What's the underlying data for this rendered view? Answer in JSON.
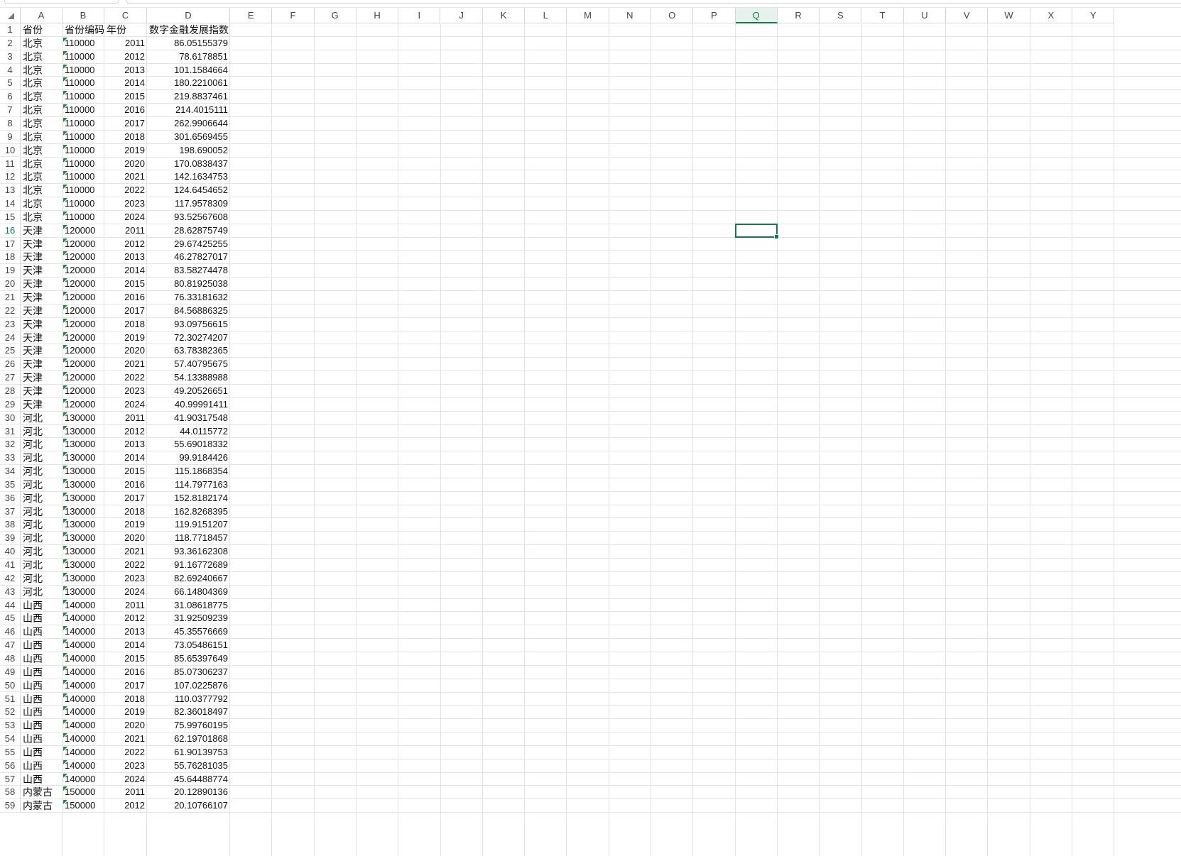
{
  "columns": [
    "A",
    "B",
    "C",
    "D",
    "E",
    "F",
    "G",
    "H",
    "I",
    "J",
    "K",
    "L",
    "M",
    "N",
    "O",
    "P",
    "Q",
    "R",
    "S",
    "T",
    "U",
    "V",
    "W",
    "X",
    "Y"
  ],
  "active_column": "Q",
  "active_row": 16,
  "selected_cell": "Q16",
  "rows": [
    {
      "n": "1",
      "a": "省份",
      "b": "省份编码",
      "c": "年份",
      "d": "数字金融发展指数",
      "header": true
    },
    {
      "n": "2",
      "a": "北京",
      "b": "110000",
      "c": "2011",
      "d": "86.05155379"
    },
    {
      "n": "3",
      "a": "北京",
      "b": "110000",
      "c": "2012",
      "d": "78.6178851"
    },
    {
      "n": "4",
      "a": "北京",
      "b": "110000",
      "c": "2013",
      "d": "101.1584664"
    },
    {
      "n": "5",
      "a": "北京",
      "b": "110000",
      "c": "2014",
      "d": "180.2210061"
    },
    {
      "n": "6",
      "a": "北京",
      "b": "110000",
      "c": "2015",
      "d": "219.8837461"
    },
    {
      "n": "7",
      "a": "北京",
      "b": "110000",
      "c": "2016",
      "d": "214.4015111"
    },
    {
      "n": "8",
      "a": "北京",
      "b": "110000",
      "c": "2017",
      "d": "262.9906644"
    },
    {
      "n": "9",
      "a": "北京",
      "b": "110000",
      "c": "2018",
      "d": "301.6569455"
    },
    {
      "n": "10",
      "a": "北京",
      "b": "110000",
      "c": "2019",
      "d": "198.690052"
    },
    {
      "n": "11",
      "a": "北京",
      "b": "110000",
      "c": "2020",
      "d": "170.0838437"
    },
    {
      "n": "12",
      "a": "北京",
      "b": "110000",
      "c": "2021",
      "d": "142.1634753"
    },
    {
      "n": "13",
      "a": "北京",
      "b": "110000",
      "c": "2022",
      "d": "124.6454652"
    },
    {
      "n": "14",
      "a": "北京",
      "b": "110000",
      "c": "2023",
      "d": "117.9578309"
    },
    {
      "n": "15",
      "a": "北京",
      "b": "110000",
      "c": "2024",
      "d": "93.52567608"
    },
    {
      "n": "16",
      "a": "天津",
      "b": "120000",
      "c": "2011",
      "d": "28.62875749"
    },
    {
      "n": "17",
      "a": "天津",
      "b": "120000",
      "c": "2012",
      "d": "29.67425255"
    },
    {
      "n": "18",
      "a": "天津",
      "b": "120000",
      "c": "2013",
      "d": "46.27827017"
    },
    {
      "n": "19",
      "a": "天津",
      "b": "120000",
      "c": "2014",
      "d": "83.58274478"
    },
    {
      "n": "20",
      "a": "天津",
      "b": "120000",
      "c": "2015",
      "d": "80.81925038"
    },
    {
      "n": "21",
      "a": "天津",
      "b": "120000",
      "c": "2016",
      "d": "76.33181632"
    },
    {
      "n": "22",
      "a": "天津",
      "b": "120000",
      "c": "2017",
      "d": "84.56886325"
    },
    {
      "n": "23",
      "a": "天津",
      "b": "120000",
      "c": "2018",
      "d": "93.09756615"
    },
    {
      "n": "24",
      "a": "天津",
      "b": "120000",
      "c": "2019",
      "d": "72.30274207"
    },
    {
      "n": "25",
      "a": "天津",
      "b": "120000",
      "c": "2020",
      "d": "63.78382365"
    },
    {
      "n": "26",
      "a": "天津",
      "b": "120000",
      "c": "2021",
      "d": "57.40795675"
    },
    {
      "n": "27",
      "a": "天津",
      "b": "120000",
      "c": "2022",
      "d": "54.13388988"
    },
    {
      "n": "28",
      "a": "天津",
      "b": "120000",
      "c": "2023",
      "d": "49.20526651"
    },
    {
      "n": "29",
      "a": "天津",
      "b": "120000",
      "c": "2024",
      "d": "40.99991411"
    },
    {
      "n": "30",
      "a": "河北",
      "b": "130000",
      "c": "2011",
      "d": "41.90317548"
    },
    {
      "n": "31",
      "a": "河北",
      "b": "130000",
      "c": "2012",
      "d": "44.0115772"
    },
    {
      "n": "32",
      "a": "河北",
      "b": "130000",
      "c": "2013",
      "d": "55.69018332"
    },
    {
      "n": "33",
      "a": "河北",
      "b": "130000",
      "c": "2014",
      "d": "99.9184426"
    },
    {
      "n": "34",
      "a": "河北",
      "b": "130000",
      "c": "2015",
      "d": "115.1868354"
    },
    {
      "n": "35",
      "a": "河北",
      "b": "130000",
      "c": "2016",
      "d": "114.7977163"
    },
    {
      "n": "36",
      "a": "河北",
      "b": "130000",
      "c": "2017",
      "d": "152.8182174"
    },
    {
      "n": "37",
      "a": "河北",
      "b": "130000",
      "c": "2018",
      "d": "162.8268395"
    },
    {
      "n": "38",
      "a": "河北",
      "b": "130000",
      "c": "2019",
      "d": "119.9151207"
    },
    {
      "n": "39",
      "a": "河北",
      "b": "130000",
      "c": "2020",
      "d": "118.7718457"
    },
    {
      "n": "40",
      "a": "河北",
      "b": "130000",
      "c": "2021",
      "d": "93.36162308"
    },
    {
      "n": "41",
      "a": "河北",
      "b": "130000",
      "c": "2022",
      "d": "91.16772689"
    },
    {
      "n": "42",
      "a": "河北",
      "b": "130000",
      "c": "2023",
      "d": "82.69240667"
    },
    {
      "n": "43",
      "a": "河北",
      "b": "130000",
      "c": "2024",
      "d": "66.14804369"
    },
    {
      "n": "44",
      "a": "山西",
      "b": "140000",
      "c": "2011",
      "d": "31.08618775"
    },
    {
      "n": "45",
      "a": "山西",
      "b": "140000",
      "c": "2012",
      "d": "31.92509239"
    },
    {
      "n": "46",
      "a": "山西",
      "b": "140000",
      "c": "2013",
      "d": "45.35576669"
    },
    {
      "n": "47",
      "a": "山西",
      "b": "140000",
      "c": "2014",
      "d": "73.05486151"
    },
    {
      "n": "48",
      "a": "山西",
      "b": "140000",
      "c": "2015",
      "d": "85.65397649"
    },
    {
      "n": "49",
      "a": "山西",
      "b": "140000",
      "c": "2016",
      "d": "85.07306237"
    },
    {
      "n": "50",
      "a": "山西",
      "b": "140000",
      "c": "2017",
      "d": "107.0225876"
    },
    {
      "n": "51",
      "a": "山西",
      "b": "140000",
      "c": "2018",
      "d": "110.0377792"
    },
    {
      "n": "52",
      "a": "山西",
      "b": "140000",
      "c": "2019",
      "d": "82.36018497"
    },
    {
      "n": "53",
      "a": "山西",
      "b": "140000",
      "c": "2020",
      "d": "75.99760195"
    },
    {
      "n": "54",
      "a": "山西",
      "b": "140000",
      "c": "2021",
      "d": "62.19701868"
    },
    {
      "n": "55",
      "a": "山西",
      "b": "140000",
      "c": "2022",
      "d": "61.90139753"
    },
    {
      "n": "56",
      "a": "山西",
      "b": "140000",
      "c": "2023",
      "d": "55.76281035"
    },
    {
      "n": "57",
      "a": "山西",
      "b": "140000",
      "c": "2024",
      "d": "45.64488774"
    },
    {
      "n": "58",
      "a": "内蒙古",
      "b": "150000",
      "c": "2011",
      "d": "20.12890136"
    },
    {
      "n": "59",
      "a": "内蒙古",
      "b": "150000",
      "c": "2012",
      "d": "20.10766107"
    }
  ]
}
